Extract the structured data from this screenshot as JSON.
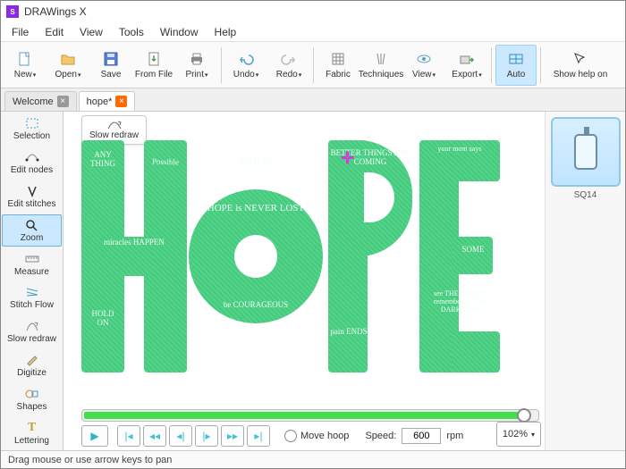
{
  "title": "DRAWings X",
  "menu": [
    "File",
    "Edit",
    "View",
    "Tools",
    "Window",
    "Help"
  ],
  "toolbar": [
    {
      "id": "new",
      "label": "New",
      "chev": true
    },
    {
      "id": "open",
      "label": "Open",
      "chev": true
    },
    {
      "id": "save",
      "label": "Save"
    },
    {
      "id": "fromfile",
      "label": "From File"
    },
    {
      "id": "print",
      "label": "Print",
      "chev": true
    },
    {
      "id": "undo",
      "label": "Undo",
      "chev": true
    },
    {
      "id": "redo",
      "label": "Redo",
      "chev": true
    },
    {
      "id": "fabric",
      "label": "Fabric"
    },
    {
      "id": "techniques",
      "label": "Techniques"
    },
    {
      "id": "view",
      "label": "View",
      "chev": true
    },
    {
      "id": "export",
      "label": "Export",
      "chev": true
    },
    {
      "id": "auto",
      "label": "Auto",
      "active": true
    },
    {
      "id": "showhelp",
      "label": "Show help on"
    }
  ],
  "tabs": [
    {
      "label": "Welcome",
      "close": "gray",
      "active": false
    },
    {
      "label": "hope*",
      "close": "orange",
      "active": true
    }
  ],
  "side": [
    {
      "id": "selection",
      "label": "Selection"
    },
    {
      "id": "editnodes",
      "label": "Edit nodes"
    },
    {
      "id": "editstitches",
      "label": "Edit stitches"
    },
    {
      "id": "zoom",
      "label": "Zoom",
      "active": true
    },
    {
      "id": "measure",
      "label": "Measure"
    },
    {
      "id": "stitchflow",
      "label": "Stitch Flow"
    },
    {
      "id": "slowredraw",
      "label": "Slow redraw"
    },
    {
      "id": "digitize",
      "label": "Digitize"
    },
    {
      "id": "shapes",
      "label": "Shapes"
    },
    {
      "id": "lettering",
      "label": "Lettering"
    }
  ],
  "chip": {
    "label": "Slow redraw"
  },
  "hoop": {
    "label": "SQ14"
  },
  "playback": {
    "move_hoop": "Move hoop",
    "speed_label": "Speed:",
    "speed_value": "600",
    "speed_unit": "rpm"
  },
  "zoom": {
    "value": "102%"
  },
  "status": "Drag mouse or use arrow keys to pan",
  "art_words": {
    "h_top": "ANY THING",
    "h_mid1": "Possible",
    "h_mid2": "miracles HAPPEN",
    "h_bot": "HOLD ON",
    "o_top": "BELIEVE",
    "o_ring": "HOPE is NEVER LOST",
    "o_bot": "be COURAGEOUS",
    "p_top": "BETTER THINGS ARE COMING",
    "p_bot": "pain ENDS",
    "e_top": "your mom says",
    "e_mid": "SOME",
    "e_bot": "see THE LIGHTS remember in THE DARKNESS"
  }
}
